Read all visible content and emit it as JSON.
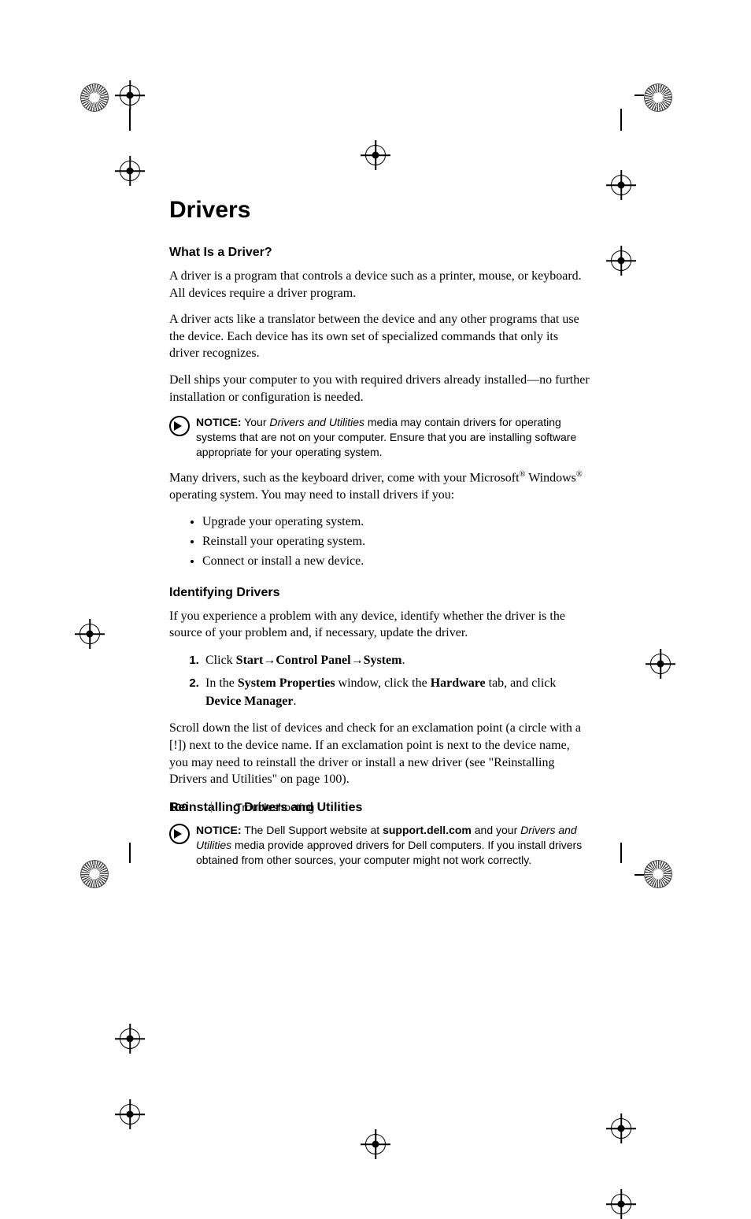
{
  "heading": "Drivers",
  "sections": {
    "what_is": {
      "title": "What Is a Driver?",
      "p1": "A driver is a program that controls a device such as a printer, mouse, or keyboard. All devices require a driver program.",
      "p2": "A driver acts like a translator between the device and any other programs that use the device. Each device has its own set of specialized commands that only its driver recognizes.",
      "p3": "Dell ships your computer to you with required drivers already installed—no further installation or configuration is needed."
    },
    "notice1": {
      "lead": "NOTICE:",
      "before_ital": " Your ",
      "ital": "Drivers and Utilities",
      "after_ital": " media may contain drivers for operating systems that are not on your computer. Ensure that you are installing software appropriate for your operating system."
    },
    "post_notice": {
      "line_pre": "Many drivers, such as the keyboard driver, come with your Microsoft",
      "reg": "®",
      "windows": " Windows",
      "line_post": " operating system. You may need to install drivers if you:",
      "bullets": [
        "Upgrade your operating system.",
        "Reinstall your operating system.",
        "Connect or install a new device."
      ]
    },
    "identifying": {
      "title": "Identifying Drivers",
      "p1": "If you experience a problem with any device, identify whether the driver is the source of your problem and, if necessary, update the driver.",
      "step1": {
        "pre": "Click ",
        "b1": "Start",
        "arrow1": "→",
        "b2": "Control Panel",
        "arrow2": "→",
        "b3": "System",
        "post": "."
      },
      "step2": {
        "pre": "In the ",
        "b1": "System Properties",
        "mid1": " window, click the ",
        "b2": "Hardware",
        "mid2": " tab, and click ",
        "b3": "Device Manager",
        "post": "."
      },
      "p2": "Scroll down the list of devices and check for an exclamation point (a circle with a [!]) next to the device name. If an exclamation point is next to the device name, you may need to reinstall the driver or install a new driver (see \"Reinstalling Drivers and Utilities\" on page 100)."
    },
    "reinstalling": {
      "title": "Reinstalling Drivers and Utilities"
    },
    "notice2": {
      "lead": "NOTICE:",
      "pre": " The Dell Support website at ",
      "bold": "support.dell.com",
      "mid": " and your ",
      "ital": "Drivers and Utilities",
      "post": " media provide approved drivers for Dell computers. If you install drivers obtained from other sources, your computer might not work correctly."
    }
  },
  "footer": {
    "page": "100",
    "section": "Troubleshooting"
  }
}
